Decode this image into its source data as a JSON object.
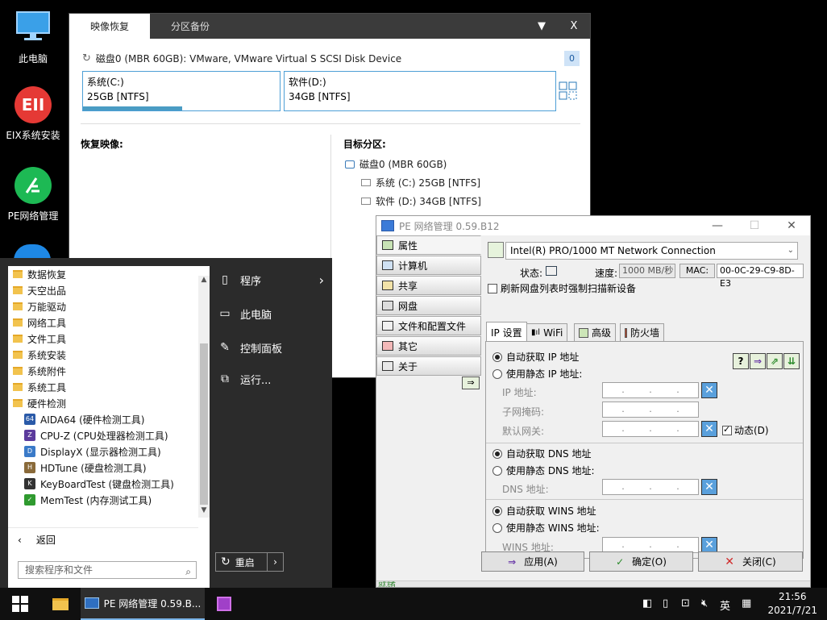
{
  "desktop": {
    "icons": [
      {
        "label": "此电脑"
      },
      {
        "label": "EIX系统安装",
        "glyph": "EII"
      },
      {
        "label": "PE网络管理"
      }
    ]
  },
  "image_recovery": {
    "tabs": [
      {
        "label": "映像恢复",
        "active": true
      },
      {
        "label": "分区备份",
        "active": false
      }
    ],
    "controls": {
      "dropdown": "▼",
      "close": "X"
    },
    "disk_title": "磁盘0 (MBR 60GB): VMware, VMware Virtual S SCSI Disk Device",
    "count_badge": "0",
    "partitions": [
      {
        "name": "系统(C:)",
        "size": "25GB [NTFS]",
        "used_fraction": 0.5
      },
      {
        "name": "软件(D:)",
        "size": "34GB [NTFS]",
        "used_fraction": 0.0
      }
    ],
    "restore_image_heading": "恢复映像:",
    "target_heading": "目标分区:",
    "tree": {
      "disk": "磁盘0 (MBR 60GB)",
      "children": [
        "系统 (C:) 25GB [NTFS]",
        "软件 (D:) 34GB [NTFS]"
      ]
    }
  },
  "start_menu": {
    "folders": [
      "数据恢复",
      "天空出品",
      "万能驱动",
      "网络工具",
      "文件工具",
      "系统安装",
      "系统附件",
      "系统工具",
      "硬件检测"
    ],
    "apps": [
      {
        "label": "AIDA64 (硬件检测工具)",
        "icon_color": "#2a5aa8",
        "icon_glyph": "64"
      },
      {
        "label": "CPU-Z (CPU处理器检测工具)",
        "icon_color": "#5b3a9c",
        "icon_glyph": "Z"
      },
      {
        "label": "DisplayX (显示器检测工具)",
        "icon_color": "#3a7ac8",
        "icon_glyph": "D"
      },
      {
        "label": "HDTune (硬盘检测工具)",
        "icon_color": "#8a6a3a",
        "icon_glyph": "H"
      },
      {
        "label": "KeyBoardTest (键盘检测工具)",
        "icon_color": "#333333",
        "icon_glyph": "K"
      },
      {
        "label": "MemTest (内存测试工具)",
        "icon_color": "#2f9a2f",
        "icon_glyph": "✓"
      }
    ],
    "back_label": "返回",
    "search_placeholder": "搜索程序和文件",
    "right_items": [
      {
        "label": "程序",
        "icon": "programs-icon",
        "has_arrow": true
      },
      {
        "label": "此电脑",
        "icon": "computer-icon"
      },
      {
        "label": "控制面板",
        "icon": "wrench-icon"
      },
      {
        "label": "运行...",
        "icon": "run-icon"
      }
    ],
    "restart_label": "重启"
  },
  "net_manager": {
    "title": "PE 网络管理 0.59.B12",
    "nav": [
      {
        "label": "属性",
        "active": true
      },
      {
        "label": "计算机"
      },
      {
        "label": "共享"
      },
      {
        "label": "网盘"
      },
      {
        "label": "文件和配置文件"
      },
      {
        "label": "其它"
      },
      {
        "label": "关于"
      }
    ],
    "adapter": "Intel(R) PRO/1000 MT Network Connection",
    "status_label": "状态:",
    "speed_label": "速度:",
    "speed_value": "1000 MB/秒",
    "mac_label": "MAC:",
    "mac_value": "00-0C-29-C9-8D-E3",
    "refresh_checkbox": "刷新网盘列表时强制扫描新设备",
    "tabs": [
      {
        "label": "IP 设置",
        "active": true
      },
      {
        "label": "WiFi"
      },
      {
        "label": "高级"
      },
      {
        "label": "防火墙"
      }
    ],
    "ip": {
      "auto_ip": "自动获取 IP 地址",
      "static_ip": "使用静态 IP 地址:",
      "ip_label": "IP 地址:",
      "mask_label": "子网掩码:",
      "gateway_label": "默认网关:",
      "dynamic_label": "动态(D)",
      "auto_dns": "自动获取 DNS 地址",
      "static_dns": "使用静态 DNS 地址:",
      "dns_label": "DNS 地址:",
      "auto_wins": "自动获取 WINS 地址",
      "static_wins": "使用静态 WINS 地址:",
      "wins_label": "WINS 地址:"
    },
    "buttons": {
      "apply": "应用(A)",
      "ok": "确定(O)",
      "close": "关闭(C)"
    },
    "statusbar": "就绪"
  },
  "taskbar": {
    "task_label": "PE 网络管理 0.59.B...",
    "ime": "英",
    "time": "21:56",
    "date": "2021/7/21"
  },
  "colors": {
    "accent": "#4a9cc4",
    "taskbar": "#101010",
    "start_bg": "#2b2b2b",
    "win_dark": "#3b3b3b"
  }
}
